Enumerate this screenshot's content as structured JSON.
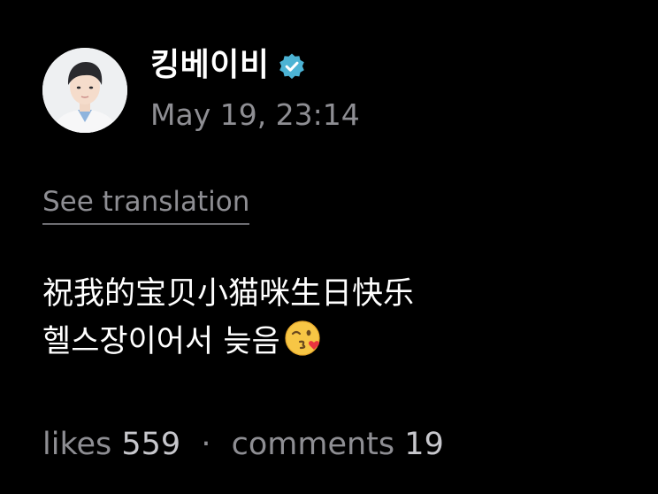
{
  "post": {
    "author": {
      "username": "킹베이비",
      "verified": true,
      "avatar_icon": "profile-photo"
    },
    "timestamp": "May 19, 23:14",
    "see_translation_label": "See translation",
    "text_lines": [
      "祝我的宝贝小猫咪生日快乐",
      "헬스장이어서 늦음"
    ],
    "emoji": "face-blowing-a-kiss",
    "stats": {
      "likes_label": "likes",
      "likes_count": "559",
      "separator": "·",
      "comments_label": "comments",
      "comments_count": "19"
    }
  },
  "colors": {
    "background": "#000000",
    "text_primary": "#ffffff",
    "text_secondary": "#8e8e93",
    "verified_badge": "#4cb3d4"
  }
}
